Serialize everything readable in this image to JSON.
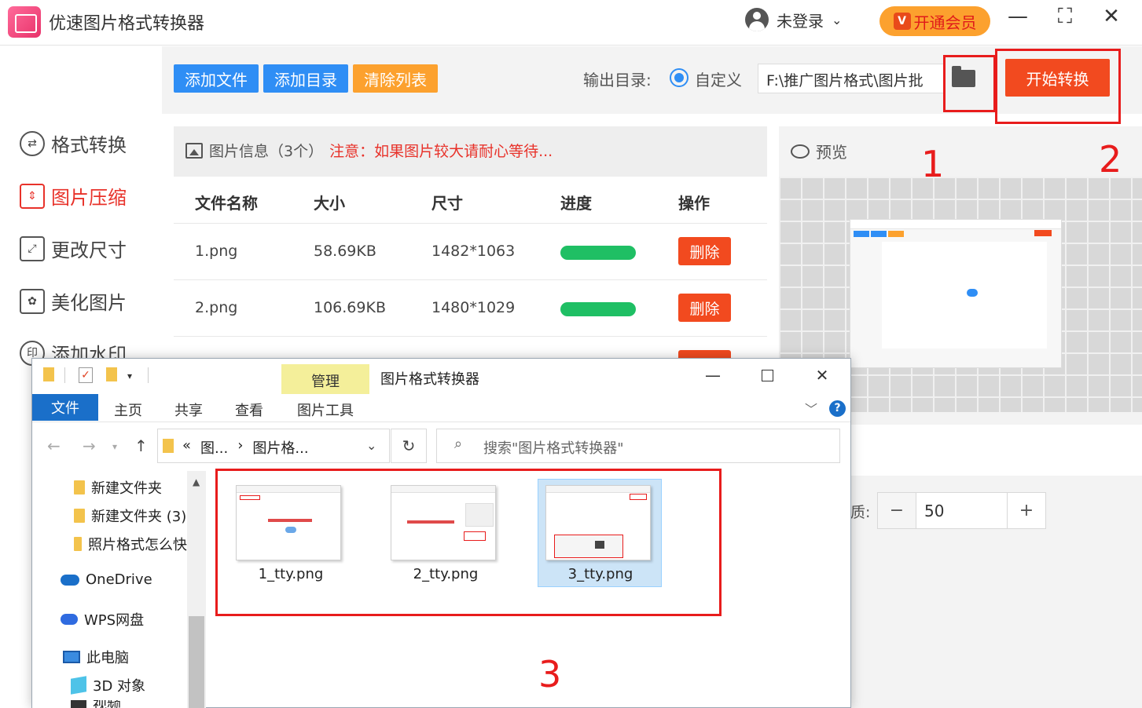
{
  "app": {
    "title": "优速图片格式转换器",
    "user": "未登录",
    "vip": "开通会员"
  },
  "window_controls": {
    "minimize": "—",
    "maximize": "⛶",
    "close": "✕"
  },
  "nav": [
    {
      "label": "格式转换",
      "icon": "convert-icon",
      "active": false
    },
    {
      "label": "图片压缩",
      "icon": "compress-icon",
      "active": true
    },
    {
      "label": "更改尺寸",
      "icon": "resize-icon",
      "active": false
    },
    {
      "label": "美化图片",
      "icon": "beautify-icon",
      "active": false
    },
    {
      "label": "添加水印",
      "icon": "watermark-icon",
      "active": false
    }
  ],
  "toolbar": {
    "add_file": "添加文件",
    "add_folder": "添加目录",
    "clear_list": "清除列表",
    "output_label": "输出目录:",
    "radio_label": "自定义",
    "output_path": "F:\\推广图片格式\\图片批",
    "start": "开始转换"
  },
  "info": {
    "title": "图片信息（3个）",
    "warning": "注意：如果图片较大请耐心等待..."
  },
  "table": {
    "headers": [
      "文件名称",
      "大小",
      "尺寸",
      "进度",
      "操作"
    ],
    "rows": [
      {
        "name": "1.png",
        "size": "58.69KB",
        "dims": "1482*1063",
        "progress": 1.0,
        "action": "删除"
      },
      {
        "name": "2.png",
        "size": "106.69KB",
        "dims": "1480*1029",
        "progress": 1.0,
        "action": "删除"
      }
    ]
  },
  "preview": {
    "title": "预览"
  },
  "quality": {
    "label": "质:",
    "value": "50",
    "minus": "−",
    "plus": "+"
  },
  "annotations": {
    "one": "1",
    "two": "2",
    "three": "3"
  },
  "explorer": {
    "ribbon_tab": "管理",
    "title": "图片格式转换器",
    "tabs": [
      "文件",
      "主页",
      "共享",
      "查看",
      "图片工具"
    ],
    "address": [
      "«",
      "图...",
      "›",
      "图片格..."
    ],
    "search_placeholder": "搜索\"图片格式转换器\"",
    "tree": [
      {
        "label": "新建文件夹",
        "icon": "folder-icon"
      },
      {
        "label": "新建文件夹 (3)",
        "icon": "folder-icon"
      },
      {
        "label": "照片格式怎么快",
        "icon": "folder-icon"
      },
      {
        "label": "OneDrive",
        "icon": "onedrive-icon"
      },
      {
        "label": "WPS网盘",
        "icon": "wps-cloud-icon"
      },
      {
        "label": "此电脑",
        "icon": "pc-icon"
      },
      {
        "label": "3D 对象",
        "icon": "3d-objects-icon"
      },
      {
        "label": "视频",
        "icon": "video-icon"
      }
    ],
    "files": [
      {
        "name": "1_tty.png",
        "selected": false
      },
      {
        "name": "2_tty.png",
        "selected": false
      },
      {
        "name": "3_tty.png",
        "selected": true
      }
    ]
  }
}
